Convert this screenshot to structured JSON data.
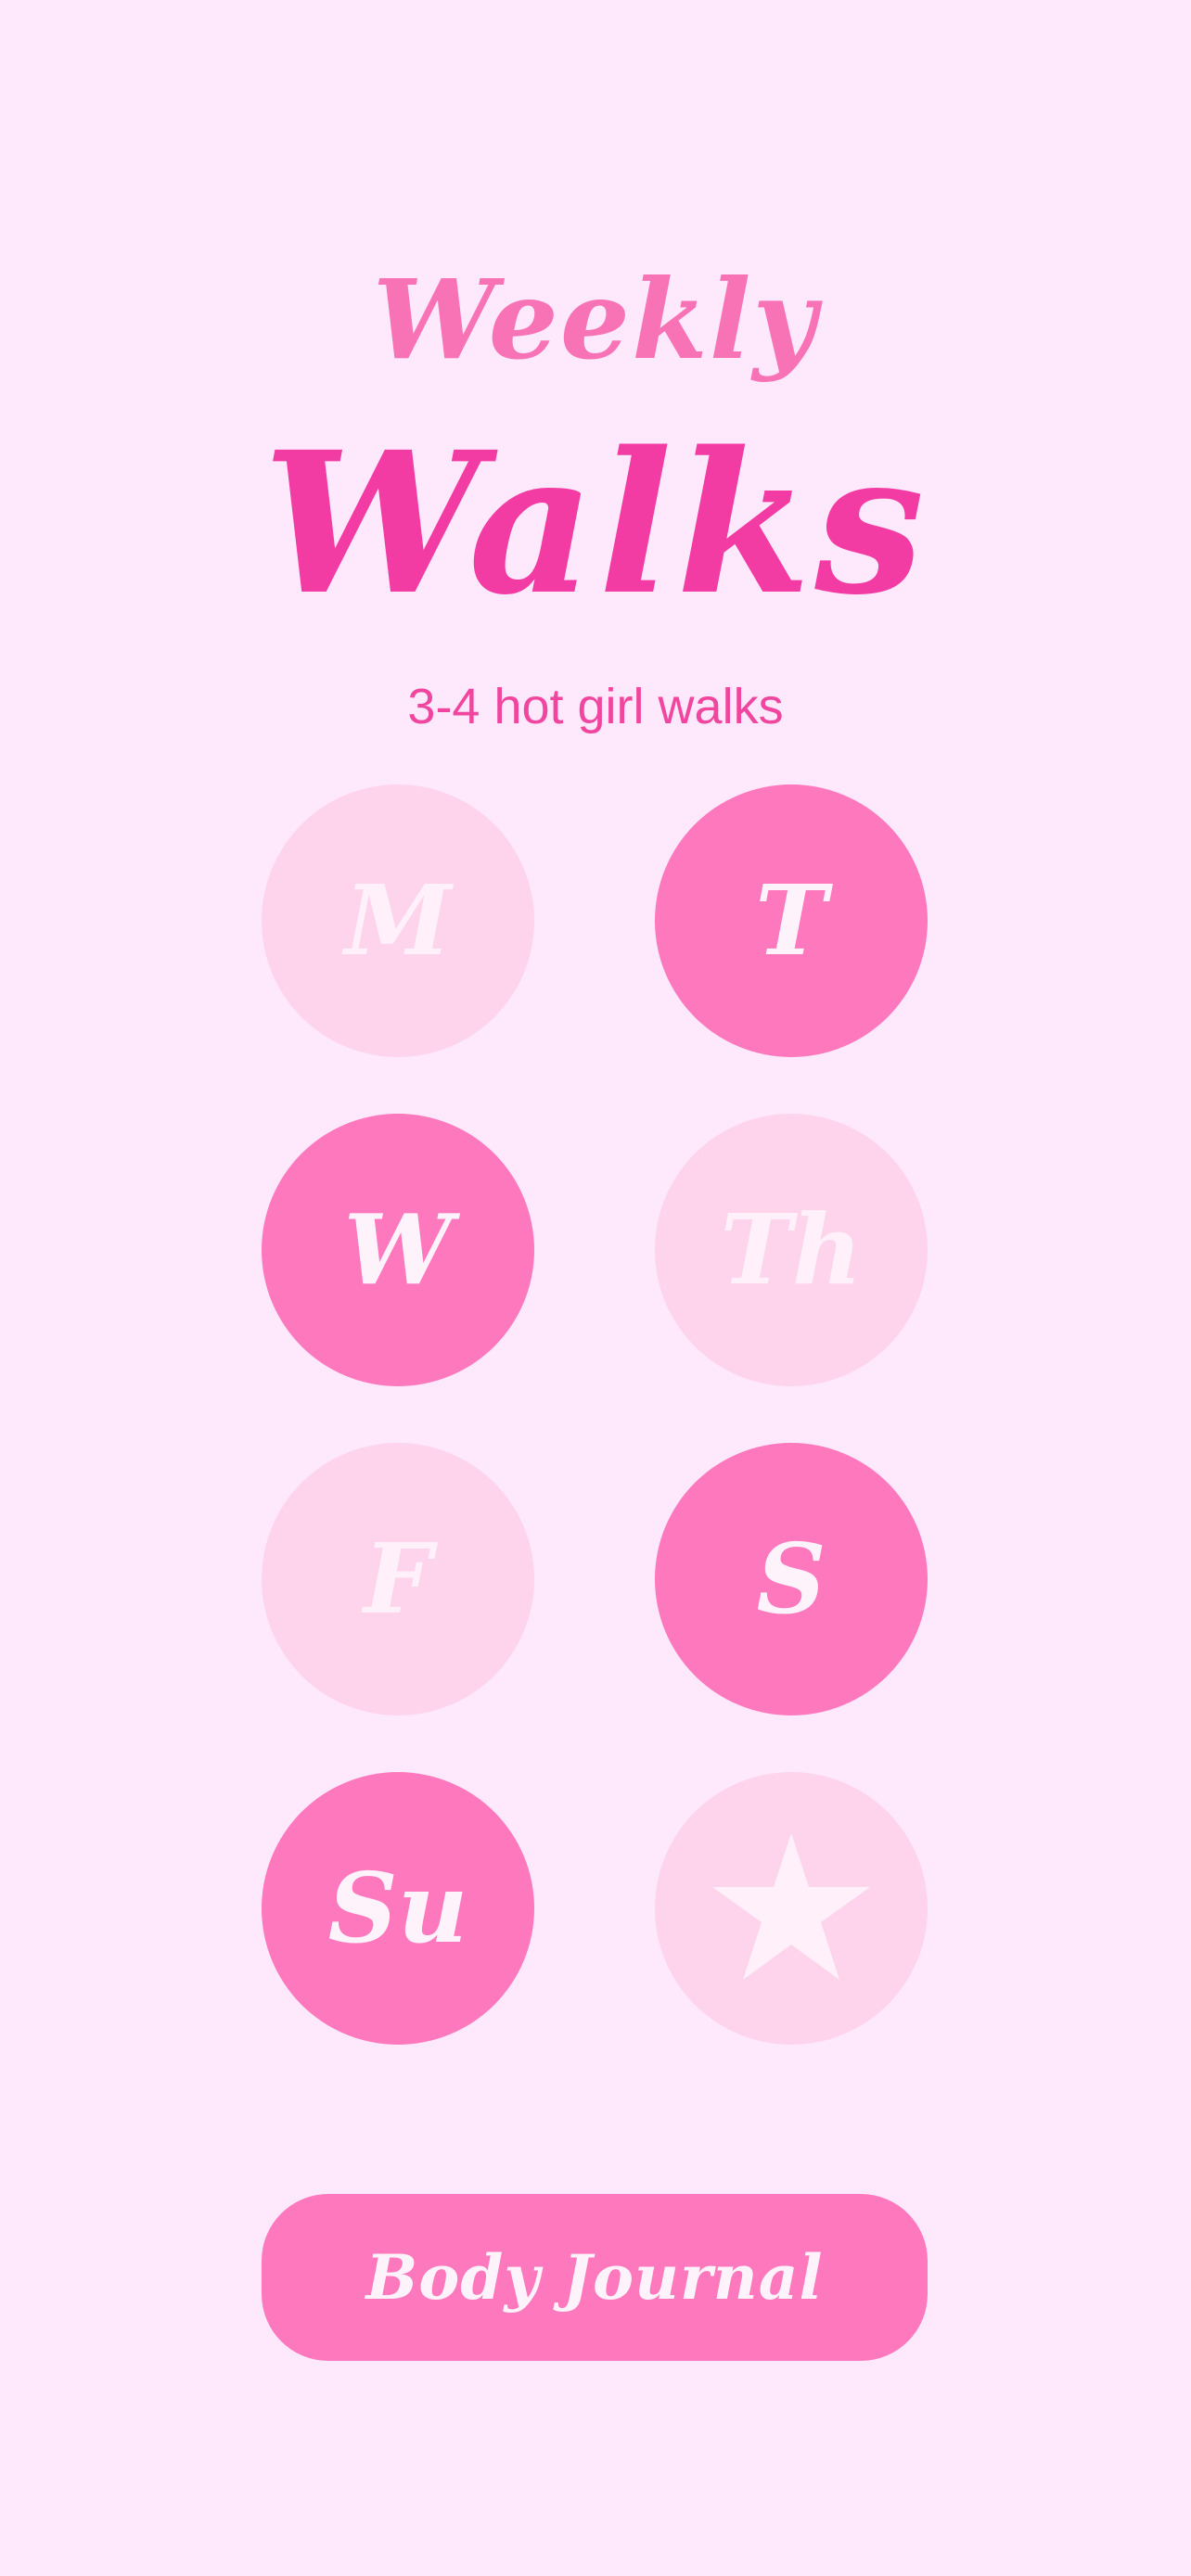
{
  "header": {
    "title_small": "Weekly",
    "title_big": "Walks",
    "subtitle": "3-4 hot girl walks"
  },
  "days": [
    {
      "label": "M",
      "done": false
    },
    {
      "label": "T",
      "done": true
    },
    {
      "label": "W",
      "done": true
    },
    {
      "label": "Th",
      "done": false
    },
    {
      "label": "F",
      "done": false
    },
    {
      "label": "S",
      "done": true
    },
    {
      "label": "Su",
      "done": true
    }
  ],
  "bonus": {
    "icon": "star-icon",
    "done": false
  },
  "footer": {
    "button_label": "Body Journal"
  },
  "colors": {
    "background": "#fde8fc",
    "done": "#fd78bd",
    "todo": "#fed4ed",
    "title": "#f23ba3",
    "accent": "#f873b5"
  }
}
